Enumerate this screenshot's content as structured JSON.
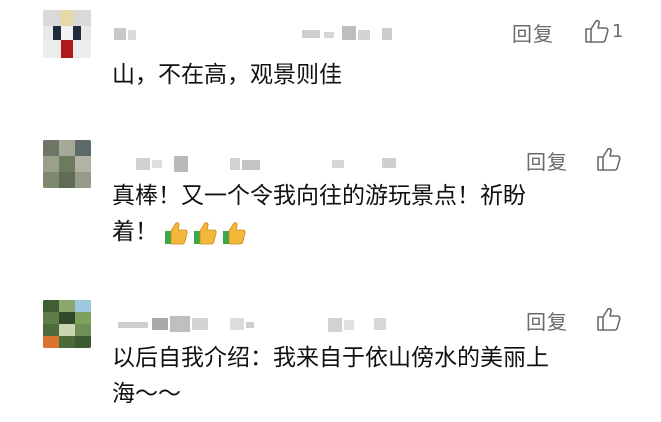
{
  "comments": [
    {
      "reply_label": "回复",
      "like_count": "1",
      "text": "山，不在高，观景则佳"
    },
    {
      "reply_label": "回复",
      "like_count": "",
      "text_line1": "真棒！又一个令我向往的游玩景点！祈盼",
      "text_line2": "着！",
      "emojis": [
        "thumbs-up-emoji",
        "thumbs-up-emoji",
        "thumbs-up-emoji"
      ]
    },
    {
      "reply_label": "回复",
      "like_count": "",
      "text_line1": "以后自我介绍：我来自于依山傍水的美丽上",
      "text_line2": "海～～"
    }
  ],
  "icons": {
    "like": "thumbs-up-outline-icon",
    "emoji": "thumbs-up-emoji"
  },
  "colors": {
    "text": "#111111",
    "meta": "#6b6b6b",
    "emoji_hand": "#f5b73b",
    "emoji_cuff": "#3aa84a"
  }
}
